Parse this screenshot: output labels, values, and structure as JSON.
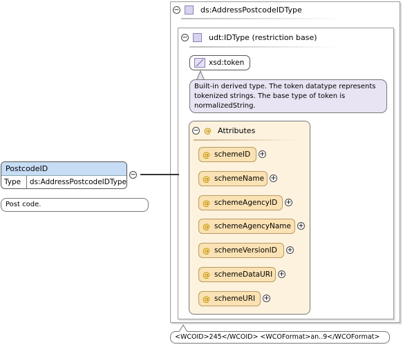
{
  "outer_type": {
    "label": "ds:AddressPostcodeIDType",
    "toggle": "−"
  },
  "restriction": {
    "label": "udt:IDType (restriction base)",
    "toggle": "−"
  },
  "base_type": {
    "label": "xsd:token"
  },
  "base_type_doc": "Built-in derived type. The token datatype represents tokenized strings. The base type of token is normalizedString.",
  "attributes": {
    "label": "Attributes",
    "toggle": "−",
    "at_symbol": "@",
    "items": [
      {
        "name": "schemeID",
        "expand": "+"
      },
      {
        "name": "schemeName",
        "expand": "+"
      },
      {
        "name": "schemeAgencyID",
        "expand": "+"
      },
      {
        "name": "schemeAgencyName",
        "expand": "+"
      },
      {
        "name": "schemeVersionID",
        "expand": "+"
      },
      {
        "name": "schemeDataURI",
        "expand": "+"
      },
      {
        "name": "schemeURI",
        "expand": "+"
      }
    ]
  },
  "element": {
    "name": "PostcodeID",
    "type_key": "Type",
    "type_value": "ds:AddressPostcodeIDType",
    "toggle": "−",
    "doc": "Post code."
  },
  "appinfo": "<WCOID>245</WCOID> <WCOFormat>an..9</WCOFormat>"
}
